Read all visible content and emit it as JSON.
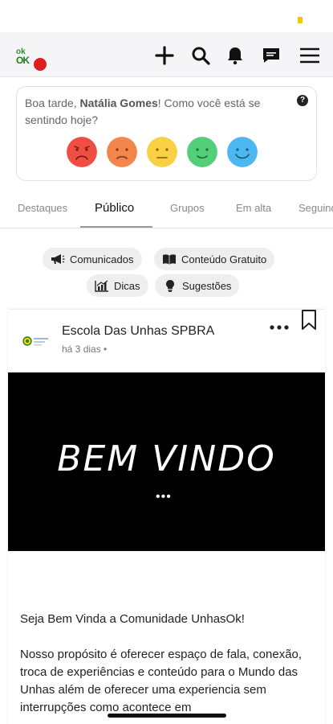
{
  "header": {
    "logo_line1": "ok",
    "logo_line2": "OK",
    "icons": [
      "plus-icon",
      "search-icon",
      "bell-icon",
      "chat-icon",
      "menu-icon"
    ]
  },
  "mood": {
    "greeting_prefix": "Boa tarde, ",
    "user_name": "Natália Gomes",
    "greeting_suffix": "! Como você está se sentindo hoje?",
    "help_label": "?",
    "options": [
      {
        "name": "very-sad",
        "color": "#f04e43"
      },
      {
        "name": "sad",
        "color": "#f3864a"
      },
      {
        "name": "neutral",
        "color": "#f9cf43"
      },
      {
        "name": "happy",
        "color": "#52cf78"
      },
      {
        "name": "very-happy",
        "color": "#4cb8ef"
      }
    ]
  },
  "tabs": [
    {
      "label": "Destaques"
    },
    {
      "label": "Público",
      "active": true
    },
    {
      "label": "Grupos"
    },
    {
      "label": "Em alta"
    },
    {
      "label": "Seguindo"
    }
  ],
  "chips": [
    {
      "label": "Comunicados",
      "icon": "megaphone-icon"
    },
    {
      "label": "Conteúdo Gratuito",
      "icon": "book-icon"
    },
    {
      "label": "Dicas",
      "icon": "chart-icon"
    },
    {
      "label": "Sugestões",
      "icon": "lightbulb-icon"
    }
  ],
  "post": {
    "author": "Escola Das Unhas SPBRA",
    "time": "há 3 dias •",
    "image_text": "BEM VINDO",
    "image_dots": "•••",
    "body": [
      "Seja Bem Vinda a Comunidade UnhasOk!",
      "Nosso propósito é oferecer espaço de fala, conexão, troca de experiências e conteúdo para o Mundo das Unhas além de oferecer uma experiencia sem interrupções como acontece em"
    ]
  },
  "colors": {
    "accent_yellow": "#f5c400",
    "badge_red": "#e01e1e",
    "logo_green": "#2c8f2c"
  }
}
